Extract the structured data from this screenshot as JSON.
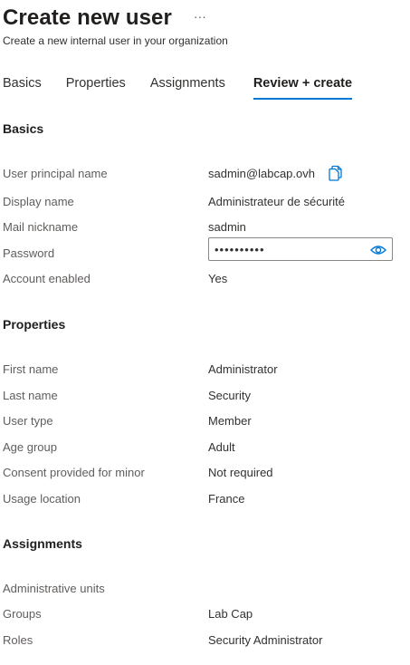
{
  "header": {
    "title": "Create new user",
    "more_label": "···",
    "subtitle": "Create a new internal user in your organization"
  },
  "tabs": [
    {
      "label": "Basics",
      "active": false
    },
    {
      "label": "Properties",
      "active": false
    },
    {
      "label": "Assignments",
      "active": false
    },
    {
      "label": "Review + create",
      "active": true
    }
  ],
  "basics": {
    "title": "Basics",
    "upn_label": "User principal name",
    "upn_value": "sadmin@labcap.ovh",
    "display_name_label": "Display name",
    "display_name_value": "Administrateur de sécurité",
    "mail_nickname_label": "Mail nickname",
    "mail_nickname_value": "sadmin",
    "password_label": "Password",
    "password_value": "••••••••••",
    "account_enabled_label": "Account enabled",
    "account_enabled_value": "Yes"
  },
  "properties": {
    "title": "Properties",
    "first_name_label": "First name",
    "first_name_value": "Administrator",
    "last_name_label": "Last name",
    "last_name_value": "Security",
    "user_type_label": "User type",
    "user_type_value": "Member",
    "age_group_label": "Age group",
    "age_group_value": "Adult",
    "consent_label": "Consent provided for minor",
    "consent_value": "Not required",
    "usage_location_label": "Usage location",
    "usage_location_value": "France"
  },
  "assignments": {
    "title": "Assignments",
    "admin_units_label": "Administrative units",
    "admin_units_value": "",
    "groups_label": "Groups",
    "groups_value": "Lab Cap",
    "roles_label": "Roles",
    "roles_value": "Security Administrator"
  },
  "icons": {
    "copy": "copy-icon",
    "eye": "eye-icon"
  },
  "colors": {
    "accent": "#0078d4",
    "text": "#323130",
    "label": "#605e5c"
  }
}
